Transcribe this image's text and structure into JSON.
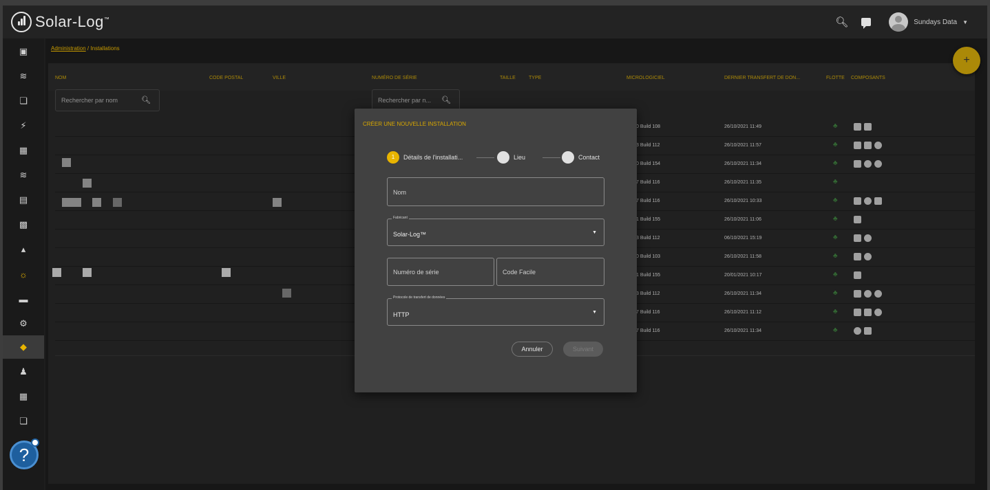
{
  "app": {
    "brand": "Solar-Log",
    "brand_tm": "™"
  },
  "topbar": {
    "user_name": "Sundays Data"
  },
  "breadcrumb": {
    "parent": "Administration",
    "separator": "/",
    "current": "Installations"
  },
  "table": {
    "headers": {
      "nom": "NOM",
      "code_postal": "CODE POSTAL",
      "ville": "VILLE",
      "numero_serie": "NUMÉRO DE SÉRIE",
      "taille": "TAILLE",
      "type": "TYPE",
      "micrologiciel": "MICROLOGICIEL",
      "dernier_transfert": "DERNIER TRANSFERT DE DON...",
      "flotte": "FLOTTE",
      "composants": "COMPOSANTS"
    },
    "search_name_placeholder": "Rechercher par nom",
    "search_serial_placeholder": "Rechercher par n...",
    "rows": [
      {
        "firmware": "0 Build 108",
        "last_transfer": "26/10/2021 11:49",
        "components": [
          "sq",
          "sq"
        ]
      },
      {
        "firmware": "3 Build 112",
        "last_transfer": "26/10/2021 11:57",
        "components": [
          "sq",
          "sq",
          "rd"
        ]
      },
      {
        "firmware": "0 Build 154",
        "last_transfer": "26/10/2021 11:34",
        "components": [
          "sq",
          "rd",
          "rd"
        ]
      },
      {
        "firmware": "7 Build 116",
        "last_transfer": "26/10/2021 11:35",
        "components": []
      },
      {
        "firmware": "7 Build 116",
        "last_transfer": "26/10/2021 10:33",
        "components": [
          "sq",
          "rd",
          "sq"
        ]
      },
      {
        "firmware": "1 Build 155",
        "last_transfer": "26/10/2021 11:06",
        "components": [
          "sq"
        ]
      },
      {
        "firmware": "3 Build 112",
        "last_transfer": "06/10/2021 15:19",
        "components": [
          "sq",
          "rd"
        ]
      },
      {
        "firmware": "0 Build 103",
        "last_transfer": "26/10/2021 11:58",
        "components": [
          "sq",
          "rd"
        ]
      },
      {
        "firmware": "1 Build 155",
        "last_transfer": "20/01/2021 10:17",
        "components": [
          "sq"
        ]
      },
      {
        "firmware": "3 Build 112",
        "last_transfer": "26/10/2021 11:34",
        "components": [
          "sq",
          "rd",
          "rd"
        ]
      },
      {
        "firmware": "7 Build 116",
        "last_transfer": "26/10/2021 11:12",
        "components": [
          "sq",
          "sq",
          "rd"
        ]
      },
      {
        "firmware": "7 Build 116",
        "last_transfer": "26/10/2021 11:34",
        "components": [
          "rd",
          "sq"
        ]
      }
    ]
  },
  "modal": {
    "title": "CRÉER UNE NOUVELLE INSTALLATION",
    "steps": [
      {
        "number": "1",
        "label": "Détails de l'installati..."
      },
      {
        "number": "",
        "label": "Lieu"
      },
      {
        "number": "",
        "label": "Contact"
      }
    ],
    "fields": {
      "nom_placeholder": "Nom",
      "fabricant_label": "Fabricant",
      "fabricant_value": "Solar-Log™",
      "serial_placeholder": "Numéro de série",
      "code_placeholder": "Code Facile",
      "protocol_label": "Protocole de transfert de données",
      "protocol_value": "HTTP"
    },
    "buttons": {
      "cancel": "Annuler",
      "next": "Suivant"
    }
  },
  "colors": {
    "accent": "#e8b400",
    "background": "#1c1c1c",
    "modal": "#414141",
    "help": "#1e5f9e"
  }
}
